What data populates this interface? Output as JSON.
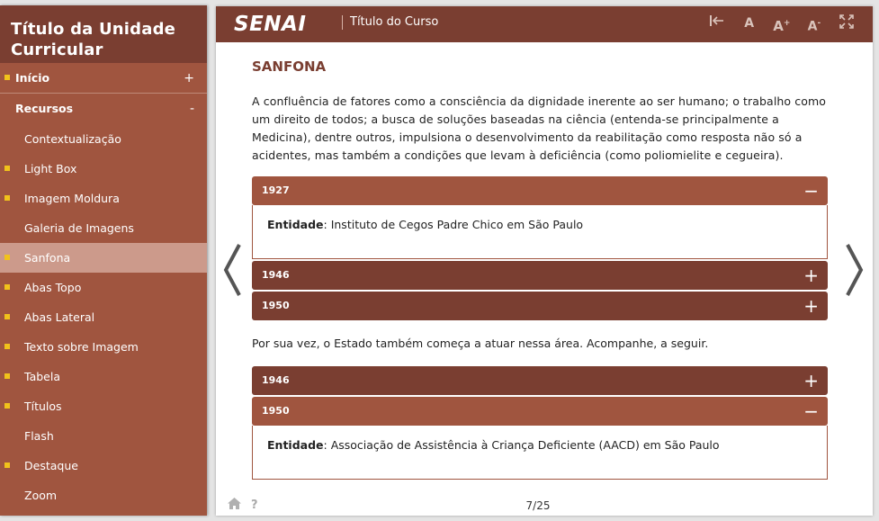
{
  "sidebar": {
    "title": "Título da Unidade Curricular",
    "sections": [
      {
        "label": "Início",
        "sign": "+",
        "bullet": true
      },
      {
        "label": "Recursos",
        "sign": "-",
        "bullet": false
      }
    ],
    "items": [
      {
        "label": "Contextualização",
        "bullet": false,
        "active": false
      },
      {
        "label": "Light Box",
        "bullet": true,
        "active": false
      },
      {
        "label": "Imagem Moldura",
        "bullet": true,
        "active": false
      },
      {
        "label": "Galeria de Imagens",
        "bullet": false,
        "active": false
      },
      {
        "label": "Sanfona",
        "bullet": true,
        "active": true
      },
      {
        "label": "Abas Topo",
        "bullet": true,
        "active": false
      },
      {
        "label": "Abas Lateral",
        "bullet": true,
        "active": false
      },
      {
        "label": "Texto sobre Imagem",
        "bullet": true,
        "active": false
      },
      {
        "label": "Tabela",
        "bullet": true,
        "active": false
      },
      {
        "label": "Títulos",
        "bullet": true,
        "active": false
      },
      {
        "label": "Flash",
        "bullet": false,
        "active": false
      },
      {
        "label": "Destaque",
        "bullet": true,
        "active": false
      },
      {
        "label": "Zoom",
        "bullet": false,
        "active": false
      }
    ]
  },
  "header": {
    "logo": "SENAI",
    "course_title": "Título do Curso",
    "tools": [
      "back-to-start-icon",
      "font-normal-icon",
      "font-increase-icon",
      "font-decrease-icon",
      "fullscreen-icon"
    ]
  },
  "main": {
    "heading": "SANFONA",
    "intro": "A confluência de fatores como a consciência da dignidade inerente ao ser humano; o trabalho como um direito de todos; a busca de soluções baseadas na ciência (entenda-se principalmente a Medicina), dentre outros, impulsiona o desenvolvimento da reabilitação como resposta não só a acidentes, mas também a condições que levam à deficiência (como poliomielite e cegueira).",
    "accordion1": [
      {
        "year": "1927",
        "open": true,
        "sign": "−",
        "entity_label": "Entidade",
        "entity_text": ": Instituto de Cegos Padre Chico em São Paulo"
      },
      {
        "year": "1946",
        "open": false,
        "sign": "+"
      },
      {
        "year": "1950",
        "open": false,
        "sign": "+"
      }
    ],
    "middle_text": "Por sua vez, o Estado também começa a atuar nessa área. Acompanhe, a seguir.",
    "accordion2": [
      {
        "year": "1946",
        "open": false,
        "sign": "+"
      },
      {
        "year": "1950",
        "open": true,
        "sign": "−",
        "entity_label": "Entidade",
        "entity_text": ": Associação de Assistência à Criança Deficiente (AACD) em São Paulo"
      }
    ]
  },
  "footer": {
    "page_indicator": "7/25"
  },
  "colors": {
    "dark_brown": "#7a3e31",
    "rust": "#a0553f",
    "active_item": "#cc9a8b",
    "bullet": "#f1c21b"
  }
}
